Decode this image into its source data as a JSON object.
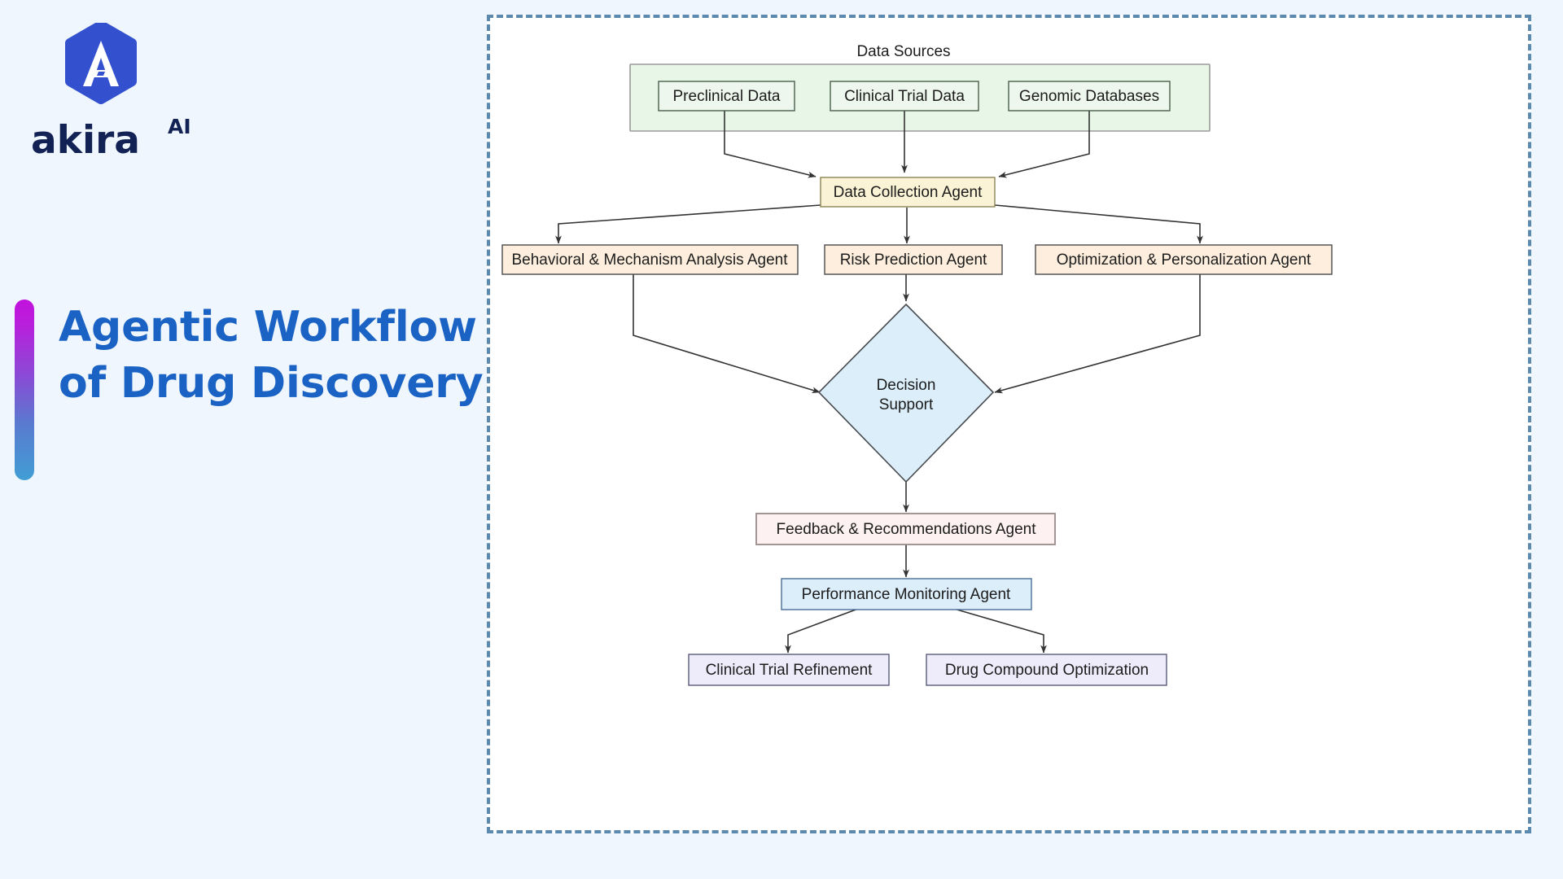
{
  "brand": {
    "logo_icon": "akira-hexagon-logo-icon",
    "name": "akira",
    "superscript": "AI",
    "logo_hex_color": "#3351cf",
    "wordmark_color": "#132254"
  },
  "title": {
    "line1": "Agentic Workflow",
    "line2": "of Drug Discovery",
    "color": "#1a63c4",
    "accent_gradient_from": "#c112dd",
    "accent_gradient_to": "#419ed4"
  },
  "canvas": {
    "background": "#eff6fd",
    "diagram_background": "#ffffff",
    "border_color": "#5c89ae",
    "border_style": "dashed"
  },
  "diagram": {
    "type": "flowchart",
    "clusters": [
      {
        "id": "data_sources",
        "label": "Data Sources",
        "fill": "#e8f6e8",
        "stroke": "#9a9a9a",
        "members": [
          "preclinical_data",
          "clinical_trial_data",
          "genomic_databases"
        ]
      }
    ],
    "nodes": [
      {
        "id": "preclinical_data",
        "label": "Preclinical Data",
        "shape": "rect",
        "fill": "#edf7ed",
        "stroke": "#4a5f4a"
      },
      {
        "id": "clinical_trial_data",
        "label": "Clinical Trial Data",
        "shape": "rect",
        "fill": "#edf7ed",
        "stroke": "#4a5f4a"
      },
      {
        "id": "genomic_databases",
        "label": "Genomic Databases",
        "shape": "rect",
        "fill": "#edf7ed",
        "stroke": "#4a5f4a"
      },
      {
        "id": "data_collection_agent",
        "label": "Data Collection Agent",
        "shape": "rect",
        "fill": "#fbf3d5",
        "stroke": "#8d8453"
      },
      {
        "id": "behavioral_agent",
        "label": "Behavioral & Mechanism Analysis Agent",
        "shape": "rect",
        "fill": "#fdeedd",
        "stroke": "#4a4a4a"
      },
      {
        "id": "risk_prediction_agent",
        "label": "Risk Prediction Agent",
        "shape": "rect",
        "fill": "#fdeedd",
        "stroke": "#4a4a4a"
      },
      {
        "id": "optimization_agent",
        "label": "Optimization & Personalization Agent",
        "shape": "rect",
        "fill": "#fdeedd",
        "stroke": "#4a4a4a"
      },
      {
        "id": "decision_support",
        "label": "Decision Support",
        "shape": "diamond",
        "fill": "#dbeefa",
        "stroke": "#46494d",
        "label_lines": [
          "Decision",
          "Support"
        ]
      },
      {
        "id": "feedback_agent",
        "label": "Feedback & Recommendations Agent",
        "shape": "rect",
        "fill": "#fdf1f1",
        "stroke": "#9b8a8a"
      },
      {
        "id": "performance_agent",
        "label": "Performance Monitoring Agent",
        "shape": "rect",
        "fill": "#ddeefb",
        "stroke": "#4a6f96"
      },
      {
        "id": "clinical_trial_refine",
        "label": "Clinical Trial Refinement",
        "shape": "rect",
        "fill": "#eeecfa",
        "stroke": "#5b5b7a"
      },
      {
        "id": "drug_compound_optimize",
        "label": "Drug Compound Optimization",
        "shape": "rect",
        "fill": "#eeecfa",
        "stroke": "#5b5b7a"
      }
    ],
    "edges": [
      {
        "from": "preclinical_data",
        "to": "data_collection_agent"
      },
      {
        "from": "clinical_trial_data",
        "to": "data_collection_agent"
      },
      {
        "from": "genomic_databases",
        "to": "data_collection_agent"
      },
      {
        "from": "data_collection_agent",
        "to": "behavioral_agent"
      },
      {
        "from": "data_collection_agent",
        "to": "risk_prediction_agent"
      },
      {
        "from": "data_collection_agent",
        "to": "optimization_agent"
      },
      {
        "from": "behavioral_agent",
        "to": "decision_support"
      },
      {
        "from": "risk_prediction_agent",
        "to": "decision_support"
      },
      {
        "from": "optimization_agent",
        "to": "decision_support"
      },
      {
        "from": "decision_support",
        "to": "feedback_agent"
      },
      {
        "from": "feedback_agent",
        "to": "performance_agent"
      },
      {
        "from": "performance_agent",
        "to": "clinical_trial_refine"
      },
      {
        "from": "performance_agent",
        "to": "drug_compound_optimize"
      }
    ]
  }
}
